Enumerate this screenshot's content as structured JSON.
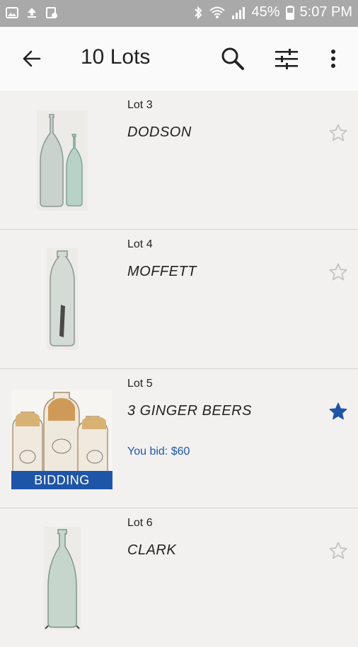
{
  "status_bar": {
    "battery": "45%",
    "time": "5:07 PM"
  },
  "app_bar": {
    "title": "10 Lots",
    "back_icon": "arrow-left-icon",
    "search_icon": "search-icon",
    "filter_icon": "filter-sliders-icon",
    "more_icon": "more-vert-icon"
  },
  "lots": [
    {
      "lot_label": "Lot 3",
      "title": "DODSON",
      "bid_text": "",
      "badge": "",
      "starred": false
    },
    {
      "lot_label": "Lot 4",
      "title": "MOFFETT",
      "bid_text": "",
      "badge": "",
      "starred": false
    },
    {
      "lot_label": "Lot 5",
      "title": "3 GINGER BEERS",
      "bid_text": "You bid: $60",
      "badge": "BIDDING",
      "starred": true
    },
    {
      "lot_label": "Lot 6",
      "title": "CLARK",
      "bid_text": "",
      "badge": "",
      "starred": false
    }
  ],
  "colors": {
    "accent": "#1f55a8",
    "star_inactive": "#c4c4c4",
    "status_bar": "#a9a9a9",
    "background": "#f1f0ee"
  }
}
